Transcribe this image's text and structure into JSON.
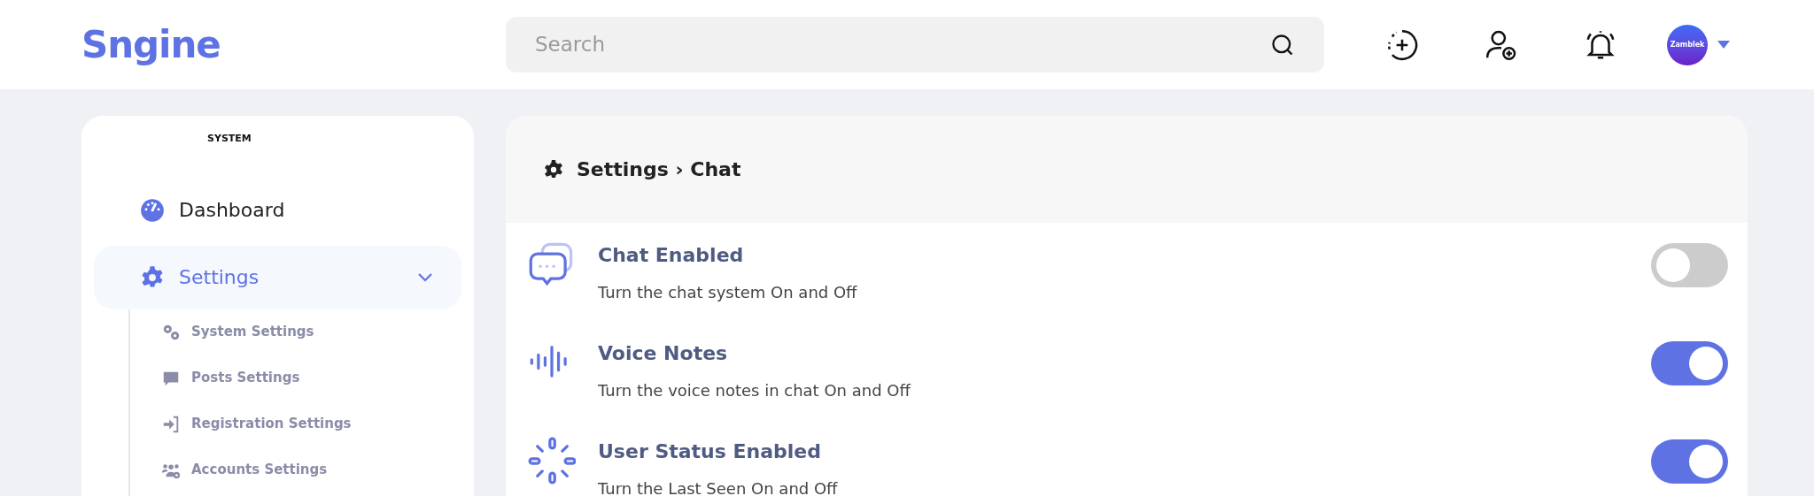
{
  "header": {
    "logo": "Sngine",
    "search": {
      "placeholder": "Search"
    },
    "avatar": {
      "label": "Zamblek"
    }
  },
  "sidebar": {
    "section": "SYSTEM",
    "items": [
      {
        "label": "Dashboard",
        "selected": false
      },
      {
        "label": "Settings",
        "selected": true,
        "expanded": true,
        "children": [
          {
            "label": "System Settings"
          },
          {
            "label": "Posts Settings"
          },
          {
            "label": "Registration Settings"
          },
          {
            "label": "Accounts Settings"
          }
        ]
      }
    ]
  },
  "panel": {
    "title": "Settings › Chat",
    "settings": [
      {
        "title": "Chat Enabled",
        "description": "Turn the chat system On and Off",
        "on": false
      },
      {
        "title": "Voice Notes",
        "description": "Turn the voice notes in chat On and Off",
        "on": true
      },
      {
        "title": "User Status Enabled",
        "description": "Turn the Last Seen On and Off",
        "on": true
      }
    ]
  }
}
